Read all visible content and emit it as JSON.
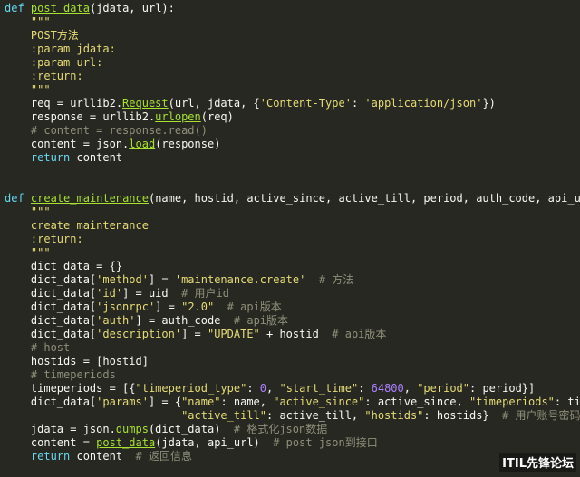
{
  "colors": {
    "background": "#272822",
    "keyword": "#66d9ef",
    "function": "#a6e22e",
    "string": "#e6db74",
    "number": "#ae81ff",
    "comment": "#8f8f7a",
    "text": "#f8f8f2"
  },
  "watermark": "ITIL先锋论坛",
  "lines": [
    {
      "tokens": [
        [
          "kw",
          "def"
        ],
        [
          "plain",
          " "
        ],
        [
          "fn",
          "post_data"
        ],
        [
          "plain",
          "(jdata, url):"
        ]
      ]
    },
    {
      "tokens": [
        [
          "doc",
          "    \"\"\""
        ]
      ]
    },
    {
      "tokens": [
        [
          "doc",
          "    POST方法"
        ]
      ]
    },
    {
      "tokens": [
        [
          "doc",
          "    :param jdata:"
        ]
      ]
    },
    {
      "tokens": [
        [
          "doc",
          "    :param url:"
        ]
      ]
    },
    {
      "tokens": [
        [
          "doc",
          "    :return:"
        ]
      ]
    },
    {
      "tokens": [
        [
          "doc",
          "    \"\"\""
        ]
      ]
    },
    {
      "tokens": [
        [
          "plain",
          "    req = urllib2."
        ],
        [
          "fn",
          "Request"
        ],
        [
          "plain",
          "(url, jdata, {"
        ],
        [
          "str",
          "'Content-Type'"
        ],
        [
          "plain",
          ": "
        ],
        [
          "str",
          "'application/json'"
        ],
        [
          "plain",
          "})"
        ]
      ]
    },
    {
      "tokens": [
        [
          "plain",
          "    response = urllib2."
        ],
        [
          "fn",
          "urlopen"
        ],
        [
          "plain",
          "(req)"
        ]
      ]
    },
    {
      "tokens": [
        [
          "cmt",
          "    # content = response.read()"
        ]
      ]
    },
    {
      "tokens": [
        [
          "plain",
          "    content = json."
        ],
        [
          "fn",
          "load"
        ],
        [
          "plain",
          "(response)"
        ]
      ]
    },
    {
      "tokens": [
        [
          "kw",
          "    return"
        ],
        [
          "plain",
          " content"
        ]
      ]
    },
    {
      "tokens": []
    },
    {
      "tokens": []
    },
    {
      "tokens": [
        [
          "kw",
          "def"
        ],
        [
          "plain",
          " "
        ],
        [
          "fn",
          "create_maintenance"
        ],
        [
          "plain",
          "(name, hostid, active_since, active_till, period, auth_code, api_url)"
        ]
      ]
    },
    {
      "tokens": [
        [
          "doc",
          "    \"\"\""
        ]
      ]
    },
    {
      "tokens": [
        [
          "doc",
          "    create maintenance"
        ]
      ]
    },
    {
      "tokens": [
        [
          "doc",
          "    :return:"
        ]
      ]
    },
    {
      "tokens": [
        [
          "doc",
          "    \"\"\""
        ]
      ]
    },
    {
      "tokens": [
        [
          "plain",
          "    dict_data = {}"
        ]
      ]
    },
    {
      "tokens": [
        [
          "plain",
          "    dict_data["
        ],
        [
          "str",
          "'method'"
        ],
        [
          "plain",
          "] = "
        ],
        [
          "str",
          "'maintenance.create'"
        ],
        [
          "plain",
          "  "
        ],
        [
          "cmt",
          "# 方法"
        ]
      ]
    },
    {
      "tokens": [
        [
          "plain",
          "    dict_data["
        ],
        [
          "str",
          "'id'"
        ],
        [
          "plain",
          "] = uid  "
        ],
        [
          "cmt",
          "# 用户id"
        ]
      ]
    },
    {
      "tokens": [
        [
          "plain",
          "    dict_data["
        ],
        [
          "str",
          "'jsonrpc'"
        ],
        [
          "plain",
          "] = "
        ],
        [
          "str",
          "\"2.0\""
        ],
        [
          "plain",
          "  "
        ],
        [
          "cmt",
          "# api版本"
        ]
      ]
    },
    {
      "tokens": [
        [
          "plain",
          "    dict_data["
        ],
        [
          "str",
          "'auth'"
        ],
        [
          "plain",
          "] = auth_code  "
        ],
        [
          "cmt",
          "# api版本"
        ]
      ]
    },
    {
      "tokens": [
        [
          "plain",
          "    dict_data["
        ],
        [
          "str",
          "'description'"
        ],
        [
          "plain",
          "] = "
        ],
        [
          "str",
          "\"UPDATE\""
        ],
        [
          "plain",
          " + hostid  "
        ],
        [
          "cmt",
          "# api版本"
        ]
      ]
    },
    {
      "tokens": [
        [
          "cmt",
          "    # host"
        ]
      ]
    },
    {
      "tokens": [
        [
          "plain",
          "    hostids = [hostid]"
        ]
      ]
    },
    {
      "tokens": [
        [
          "cmt",
          "    # timeperiods"
        ]
      ]
    },
    {
      "tokens": [
        [
          "plain",
          "    timeperiods = [{"
        ],
        [
          "str",
          "\"timeperiod_type\""
        ],
        [
          "plain",
          ": "
        ],
        [
          "num",
          "0"
        ],
        [
          "plain",
          ", "
        ],
        [
          "str",
          "\"start_time\""
        ],
        [
          "plain",
          ": "
        ],
        [
          "num",
          "64800"
        ],
        [
          "plain",
          ", "
        ],
        [
          "str",
          "\"period\""
        ],
        [
          "plain",
          ": period}]"
        ]
      ]
    },
    {
      "tokens": [
        [
          "plain",
          "    dict_data["
        ],
        [
          "str",
          "'params'"
        ],
        [
          "plain",
          "] = {"
        ],
        [
          "str",
          "\"name\""
        ],
        [
          "plain",
          ": name, "
        ],
        [
          "str",
          "\"active_since\""
        ],
        [
          "plain",
          ": active_since, "
        ],
        [
          "str",
          "\"timeperiods\""
        ],
        [
          "plain",
          ": timep"
        ]
      ]
    },
    {
      "tokens": [
        [
          "plain",
          "                           "
        ],
        [
          "str",
          "\"active_till\""
        ],
        [
          "plain",
          ": active_till, "
        ],
        [
          "str",
          "\"hostids\""
        ],
        [
          "plain",
          ": hostids}  "
        ],
        [
          "cmt",
          "# 用户账号密码"
        ]
      ]
    },
    {
      "tokens": [
        [
          "plain",
          "    jdata = json."
        ],
        [
          "fn",
          "dumps"
        ],
        [
          "plain",
          "(dict_data)  "
        ],
        [
          "cmt",
          "# 格式化json数据"
        ]
      ]
    },
    {
      "tokens": [
        [
          "plain",
          "    content = "
        ],
        [
          "fn",
          "post_data"
        ],
        [
          "plain",
          "(jdata, api_url)  "
        ],
        [
          "cmt",
          "# post json到接口"
        ]
      ]
    },
    {
      "tokens": [
        [
          "kw",
          "    return"
        ],
        [
          "plain",
          " content  "
        ],
        [
          "cmt",
          "# 返回信息"
        ]
      ]
    }
  ]
}
